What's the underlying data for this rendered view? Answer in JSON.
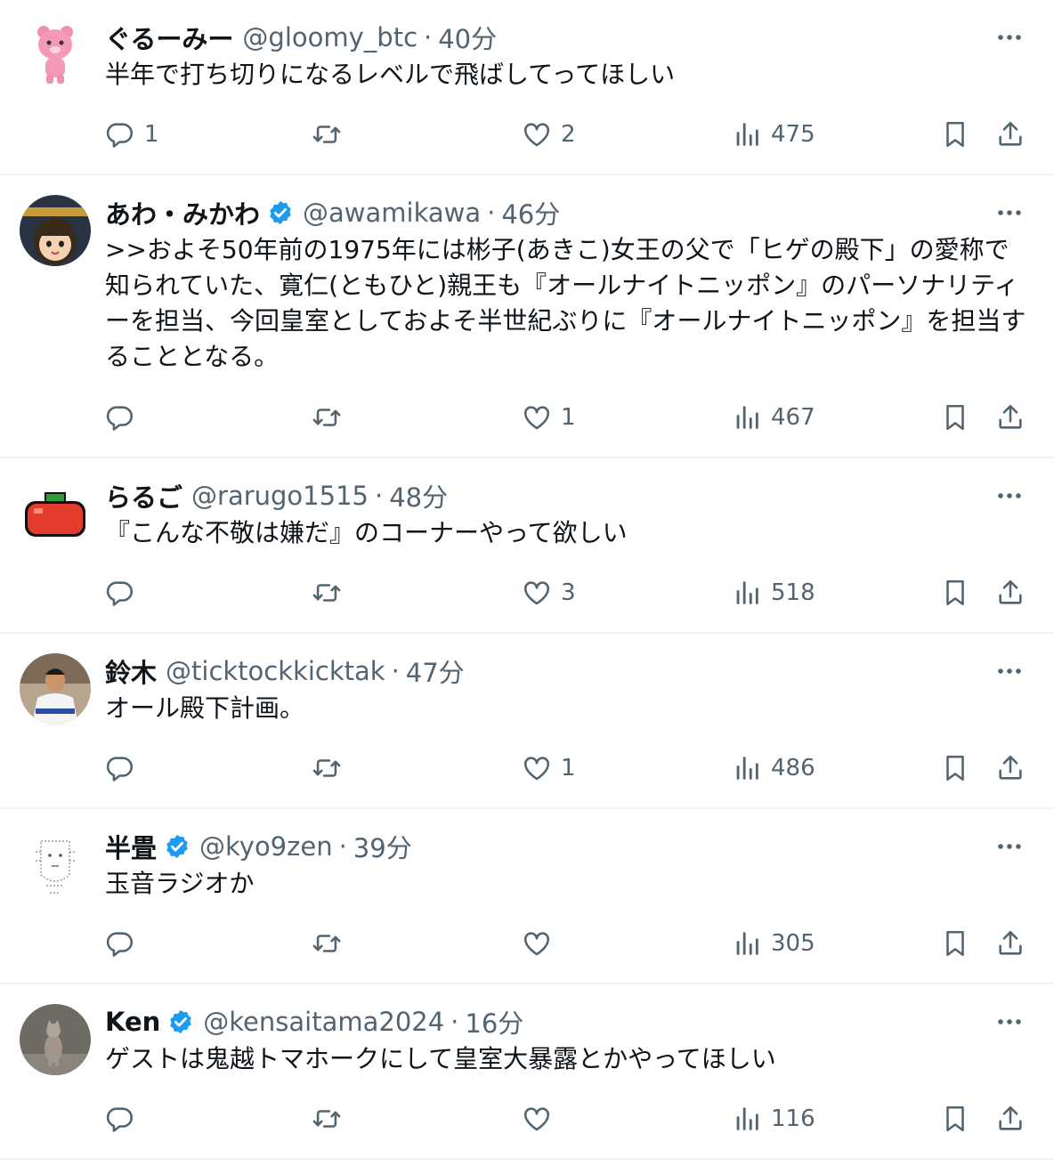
{
  "tweets": [
    {
      "name": "ぐるーみー",
      "handle": "@gloomy_btc",
      "sep": "·",
      "time": "40分",
      "verified": false,
      "avatar": "pink-bear-avatar",
      "text": "半年で打ち切りになるレベルで飛ばしてってほしい",
      "replies": "1",
      "retweets": "",
      "likes": "2",
      "views": "475"
    },
    {
      "name": "あわ・みかわ",
      "handle": "@awamikawa",
      "sep": "·",
      "time": "46分",
      "verified": true,
      "avatar": "anime-girl-avatar",
      "text": ">>およそ50年前の1975年には彬子(あきこ)女王の父で「ヒゲの殿下」の愛称で知られていた、寛仁(ともひと)親王も『オールナイトニッポン』のパーソナリティーを担当、今回皇室としておよそ半世紀ぶりに『オールナイトニッポン』を担当することとなる。",
      "replies": "",
      "retweets": "",
      "likes": "1",
      "views": "467"
    },
    {
      "name": "らるご",
      "handle": "@rarugo1515",
      "sep": "·",
      "time": "48分",
      "verified": false,
      "avatar": "pixel-tomato-avatar",
      "text": "『こんな不敬は嫌だ』のコーナーやって欲しい",
      "replies": "",
      "retweets": "",
      "likes": "3",
      "views": "518"
    },
    {
      "name": "鈴木",
      "handle": "@ticktockkicktak",
      "sep": "·",
      "time": "47分",
      "verified": false,
      "avatar": "judo-photo-avatar",
      "text": "オール殿下計画。",
      "replies": "",
      "retweets": "",
      "likes": "1",
      "views": "486"
    },
    {
      "name": "半畳",
      "handle": "@kyo9zen",
      "sep": "·",
      "time": "39分",
      "verified": true,
      "avatar": "text-art-face-avatar",
      "text": "玉音ラジオか",
      "replies": "",
      "retweets": "",
      "likes": "",
      "views": "305"
    },
    {
      "name": "Ken",
      "handle": "@kensaitama2024",
      "sep": "·",
      "time": "16分",
      "verified": true,
      "avatar": "cat-photo-avatar",
      "text": "ゲストは鬼越トマホークにして皇室大暴露とかやってほしい",
      "replies": "",
      "retweets": "",
      "likes": "",
      "views": "116"
    }
  ],
  "colors": {
    "text": "#0f1419",
    "muted": "#536471",
    "verified": "#1d9bf0",
    "divider": "#eff3f4"
  },
  "icons": [
    "reply-icon",
    "retweet-icon",
    "like-icon",
    "views-icon",
    "bookmark-icon",
    "share-icon",
    "more-icon",
    "verified-badge-icon"
  ]
}
